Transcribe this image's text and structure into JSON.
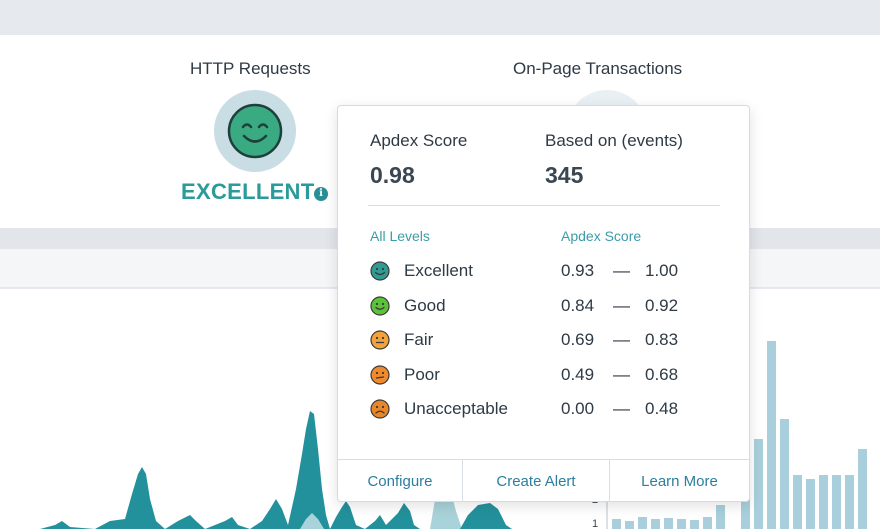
{
  "metrics": {
    "http_requests": {
      "title": "HTTP Requests",
      "rating": "EXCELLENT"
    },
    "on_page_transactions": {
      "title": "On-Page Transactions"
    }
  },
  "tooltip": {
    "apdex_label": "Apdex Score",
    "apdex_value": "0.98",
    "events_label": "Based on (events)",
    "events_value": "345",
    "col_levels": "All Levels",
    "col_score": "Apdex Score",
    "dash": "—",
    "levels": [
      {
        "name": "Excellent",
        "min": "0.93",
        "max": "1.00",
        "color": "#2f9b93",
        "icon": "excellent-face-icon"
      },
      {
        "name": "Good",
        "min": "0.84",
        "max": "0.92",
        "color": "#5cc23a",
        "icon": "good-face-icon"
      },
      {
        "name": "Fair",
        "min": "0.69",
        "max": "0.83",
        "color": "#f2a23a",
        "icon": "fair-face-icon"
      },
      {
        "name": "Poor",
        "min": "0.49",
        "max": "0.68",
        "color": "#f08a2c",
        "icon": "poor-face-icon"
      },
      {
        "name": "Unacceptable",
        "min": "0.00",
        "max": "0.48",
        "color": "#e8862a",
        "icon": "unacceptable-face-icon"
      }
    ],
    "buttons": {
      "configure": "Configure",
      "create_alert": "Create Alert",
      "learn_more": "Learn More"
    }
  },
  "right_chart": {
    "tick_labels": [
      "2",
      "1"
    ]
  },
  "colors": {
    "accent": "#2a9a9a",
    "peak": "#23919c",
    "bar": "#a8cfdb"
  }
}
